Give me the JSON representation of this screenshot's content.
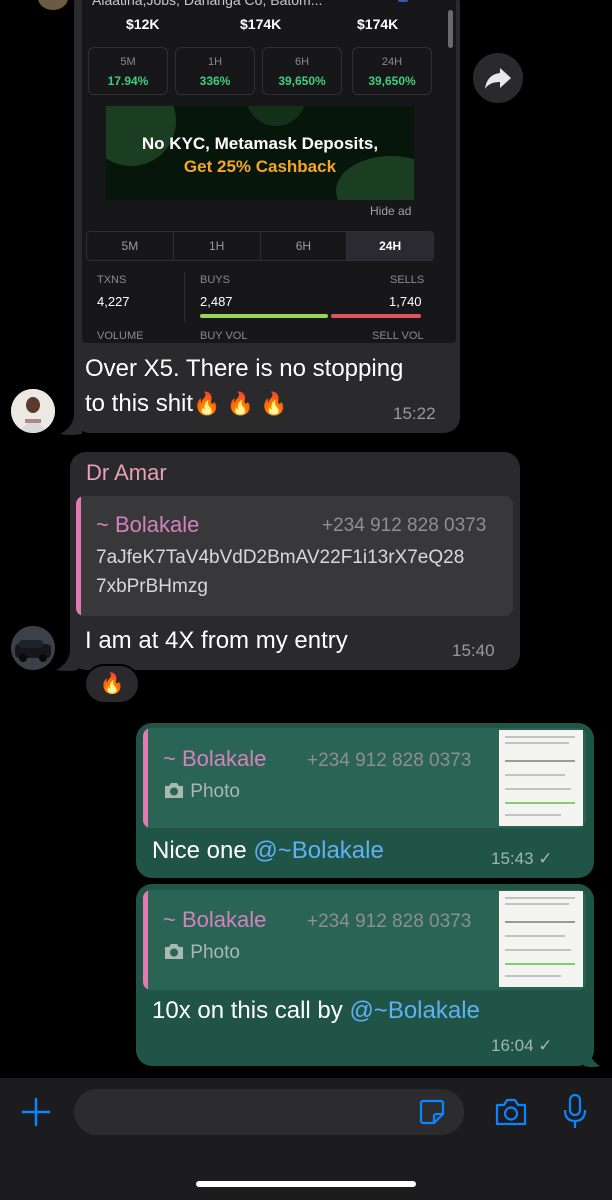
{
  "card": {
    "header_text": "Alaatiha,Jobs, Dahanga Co, Batom...",
    "prices": [
      "$12K",
      "$174K",
      "$174K"
    ],
    "stats": [
      {
        "label": "5M",
        "value": "17.94%"
      },
      {
        "label": "1H",
        "value": "336%"
      },
      {
        "label": "6H",
        "value": "39,650%"
      },
      {
        "label": "24H",
        "value": "39,650%"
      }
    ],
    "ad_line1": "No KYC, Metamask Deposits,",
    "ad_line2": "Get 25% Cashback",
    "hide_ad": "Hide ad",
    "tabs": [
      "5M",
      "1H",
      "6H",
      "24H"
    ],
    "active_tab": "24H",
    "txns_label": "TXNS",
    "txns_value": "4,227",
    "buys_label": "BUYS",
    "buys_value": "2,487",
    "sells_label": "SELLS",
    "sells_value": "1,740",
    "volume_label": "VOLUME",
    "buy_vol_label": "BUY VOL",
    "sell_vol_label": "SELL VOL"
  },
  "messages": [
    {
      "text_line1": "Over X5. There is no stopping",
      "text_line2": "to this shit",
      "emoji": "🔥 🔥 🔥",
      "time": "15:22"
    },
    {
      "sender": "Dr Amar",
      "quote_name": "~ Bolakale",
      "quote_phone": "+234 912 828 0373",
      "quote_line1": "7aJfeK7TaV4bVdD2BmAV22F1i13rX7eQ28",
      "quote_line2": "7xbPrBHmzg",
      "text": "I am at 4X from my entry",
      "time": "15:40",
      "reaction": "🔥"
    },
    {
      "quote_name": "~ Bolakale",
      "quote_phone": "+234 912 828 0373",
      "quote_photo": "Photo",
      "text": "Nice one ",
      "mention": "@~Bolakale",
      "time": "15:43",
      "status": "✓"
    },
    {
      "quote_name": "~ Bolakale",
      "quote_phone": "+234 912 828 0373",
      "quote_photo": "Photo",
      "text": "10x on this call by ",
      "mention": "@~Bolakale",
      "time": "16:04",
      "status": "✓"
    }
  ],
  "composer": {
    "placeholder": ""
  },
  "colors": {
    "outgoing": "#1f5446",
    "incoming": "#2a2a2c",
    "accent": "#0a84ff",
    "mention": "#5fb1f5"
  }
}
